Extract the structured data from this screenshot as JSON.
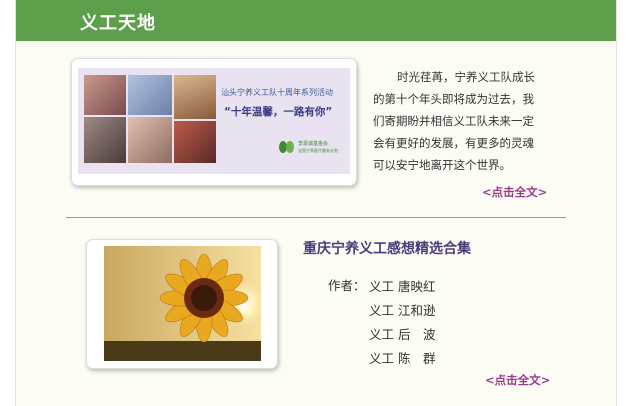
{
  "header": {
    "title": "义工天地"
  },
  "feature": {
    "banner_line1": "汕头宁养义工队十周年系列活动",
    "banner_line2": "“十年温馨，一路有你”",
    "logo_text": "李嘉诚基金会",
    "logo_sub": "全国宁养医疗服务计划",
    "paragraph": "时光荏苒，宁养义工队成长的第十个年头即将成为过去，我们寄期盼并相信义工队未来一定会有更好的发展，有更多的灵魂可以安宁地离开这个世界。",
    "more_label": "<点击全文>"
  },
  "article": {
    "title": "重庆宁养义工感想精选合集",
    "author_label": "作者：",
    "authors": [
      "义工 唐映红",
      "义工 江和逊",
      "义工 后　波",
      "义工 陈　群"
    ],
    "more_label": "<点击全文>"
  },
  "colors": {
    "header_bg": "#5c9e4a",
    "link": "#9a3c8c",
    "title": "#4b3c7c"
  }
}
